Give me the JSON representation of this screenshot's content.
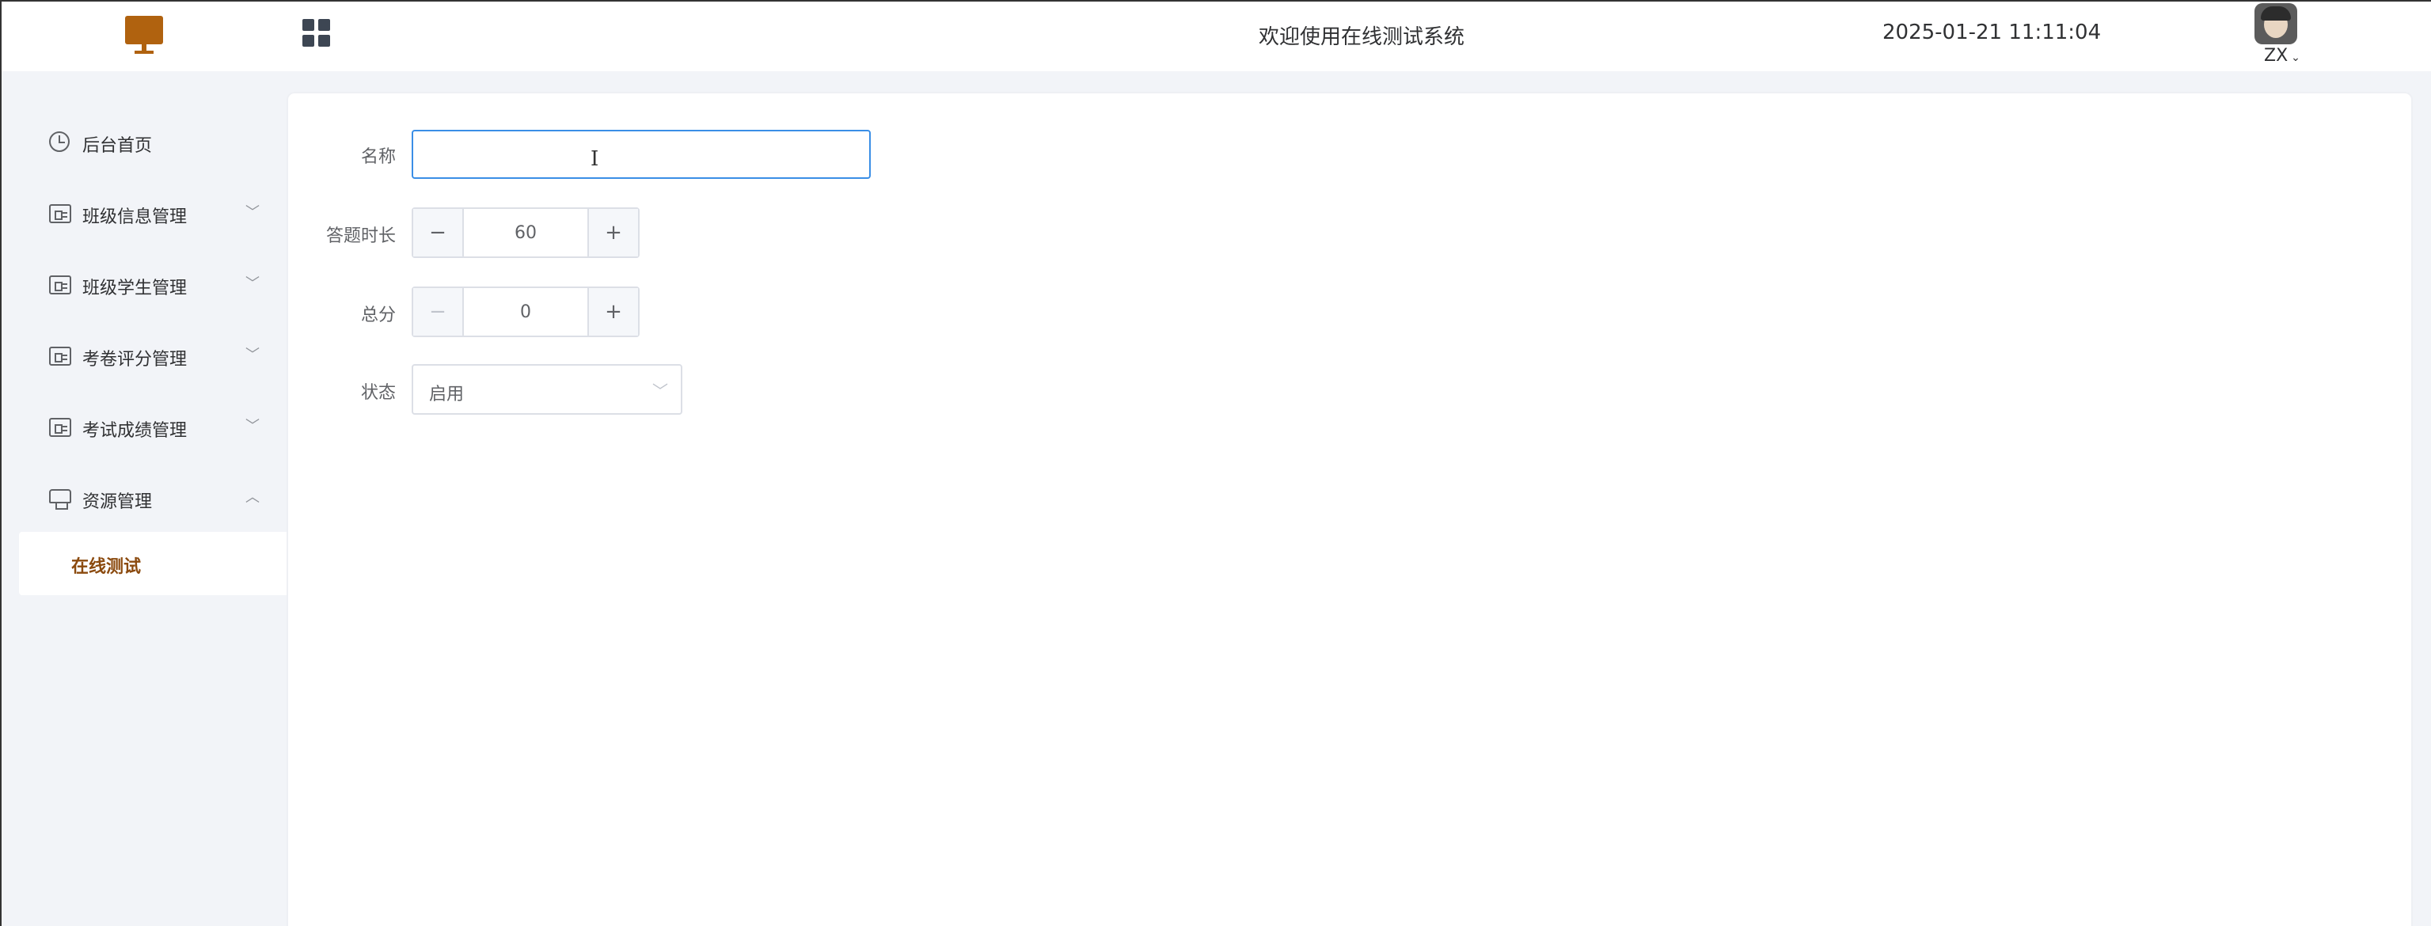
{
  "header": {
    "welcome": "欢迎使用在线测试系统",
    "datetime": "2025-01-21 11:11:04",
    "user": "ZX",
    "accent_color": "#b0620f"
  },
  "sidebar": {
    "items": [
      {
        "label": "后台首页",
        "icon": "clock-icon"
      },
      {
        "label": "班级信息管理",
        "icon": "card-icon",
        "arrow": "﹀"
      },
      {
        "label": "班级学生管理",
        "icon": "card-icon",
        "arrow": "﹀"
      },
      {
        "label": "考卷评分管理",
        "icon": "card-icon",
        "arrow": "﹀"
      },
      {
        "label": "考试成绩管理",
        "icon": "card-icon",
        "arrow": "﹀"
      },
      {
        "label": "资源管理",
        "icon": "resource-icon",
        "arrow": "︿"
      }
    ],
    "subitems": [
      {
        "label": "在线测试",
        "active": true
      }
    ]
  },
  "form": {
    "name_label": "名称",
    "name_value": "",
    "duration_label": "答题时长",
    "duration_value": "60",
    "score_label": "总分",
    "score_value": "0",
    "status_label": "状态",
    "status_value": "启用",
    "minus": "−",
    "plus": "+"
  }
}
